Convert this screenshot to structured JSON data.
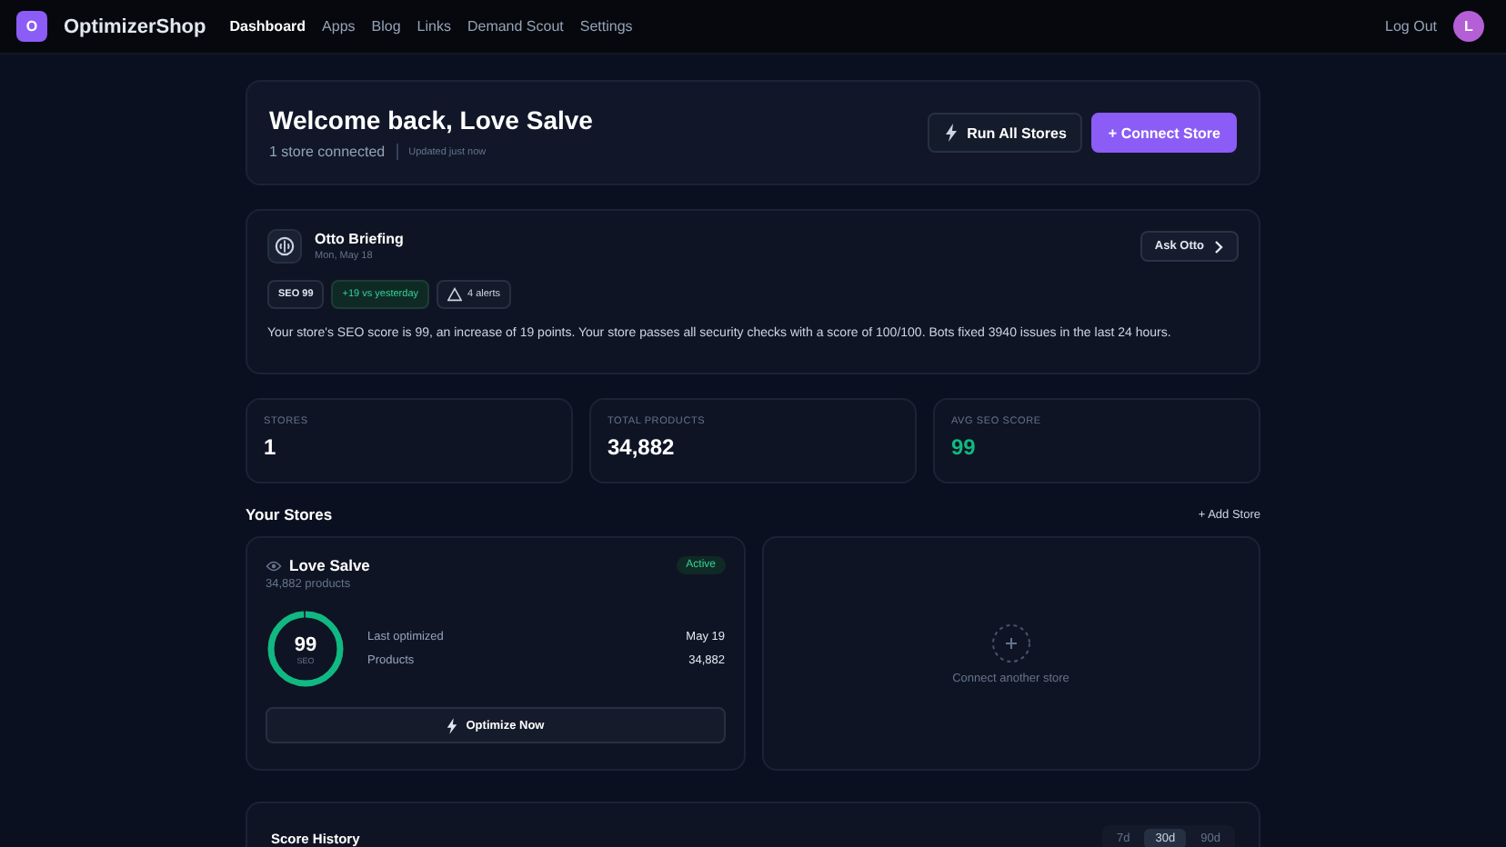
{
  "nav": {
    "brand": "OptimizerShop",
    "logo_letter": "O",
    "links": [
      {
        "label": "Dashboard",
        "selected": true
      },
      {
        "label": "Apps",
        "selected": false
      },
      {
        "label": "Blog",
        "selected": false
      },
      {
        "label": "Links",
        "selected": false
      },
      {
        "label": "Demand Scout",
        "selected": false
      },
      {
        "label": "Settings",
        "selected": false
      }
    ],
    "logout": "Log Out",
    "avatar_letter": "L"
  },
  "welcome": {
    "title": "Welcome back, Love Salve",
    "subtitle": "1 store connected",
    "updated": "Updated just now",
    "buttons": [
      {
        "label": "Run All Stores",
        "kind": "secondary"
      },
      {
        "label": "+ Connect Store",
        "kind": "primary"
      }
    ]
  },
  "briefing": {
    "title": "Otto Briefing",
    "date": "Mon, May 18",
    "ask": "Ask Otto",
    "chips": [
      {
        "label": "SEO 99",
        "kind": "plain"
      },
      {
        "label": "+19 vs yesterday",
        "kind": "positive"
      },
      {
        "label": "4 alerts",
        "kind": "alert"
      }
    ],
    "text": "Your store's SEO score is 99, an increase of 19 points. Your store passes all security checks with a score of 100/100. Bots fixed 3940 issues in the last 24 hours."
  },
  "stats": [
    {
      "label": "STORES",
      "value": "1",
      "kind": "plain"
    },
    {
      "label": "TOTAL PRODUCTS",
      "value": "34,882",
      "kind": "plain"
    },
    {
      "label": "AVG SEO SCORE",
      "value": "99",
      "kind": "good"
    }
  ],
  "stores": {
    "title": "Your Stores",
    "add": "+ Add Store",
    "items": [
      {
        "name": "Love Salve",
        "products": "34,882 products",
        "status": "Active",
        "score": "99",
        "score_label": "SEO",
        "level": 0.99,
        "rows": [
          {
            "label": "Last optimized",
            "value": "May 19"
          },
          {
            "label": "Products",
            "value": "34,882"
          }
        ],
        "action": "Optimize Now"
      }
    ],
    "connect": "Connect another store"
  },
  "history": {
    "title": "Score History",
    "ranges": [
      {
        "label": "7d",
        "selected": false
      },
      {
        "label": "30d",
        "selected": true
      },
      {
        "label": "90d",
        "selected": false
      }
    ]
  }
}
